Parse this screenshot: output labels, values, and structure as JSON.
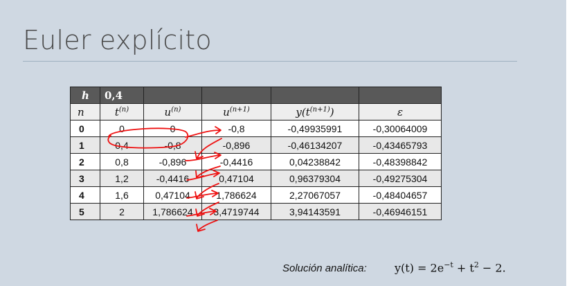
{
  "slide": {
    "title": "Euler explícito"
  },
  "table": {
    "h_label": "h",
    "h_value": "0,4",
    "col_headers": [
      "n",
      "t(n)",
      "u(n)",
      "u(n+1)",
      "y(t(n+1))",
      "ε"
    ],
    "rows": [
      [
        "0",
        "0",
        "0",
        "-0,8",
        "-0,49935991",
        "-0,30064009"
      ],
      [
        "1",
        "0,4",
        "-0,8",
        "-0,896",
        "-0,46134207",
        "-0,43465793"
      ],
      [
        "2",
        "0,8",
        "-0,896",
        "-0,4416",
        "0,04238842",
        "-0,48398842"
      ],
      [
        "3",
        "1,2",
        "-0,4416",
        "0,47104",
        "0,96379304",
        "-0,49275304"
      ],
      [
        "4",
        "1,6",
        "0,47104",
        "1,786624",
        "2,27067057",
        "-0,48404657"
      ],
      [
        "5",
        "2",
        "1,786624",
        "3,4719744",
        "3,94143591",
        "-0,46946151"
      ]
    ]
  },
  "analytic": {
    "label": "Solución analítica:",
    "formula": "y(t) = 2e−t + t2 − 2."
  },
  "colors": {
    "background": "#cfd8e2",
    "header_dark": "#595959",
    "annotation_red": "#ee1111"
  }
}
